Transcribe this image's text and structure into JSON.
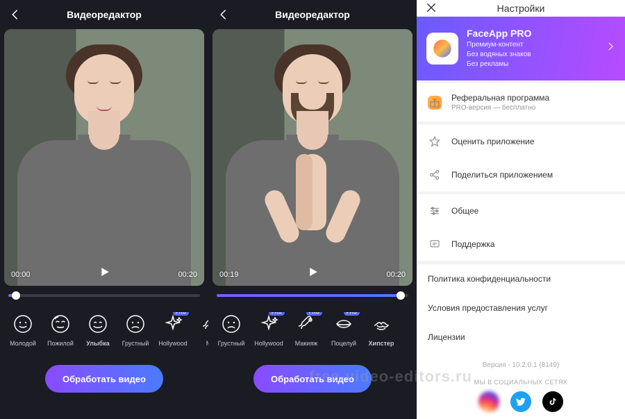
{
  "editor": {
    "title": "Видеоредактор",
    "process_label": "Обработать видео",
    "left": {
      "time_start": "00:00",
      "time_end": "00:20",
      "progress": 0.04
    },
    "right": {
      "time_start": "00:19",
      "time_end": "00:20",
      "progress": 0.96
    },
    "filters_left": [
      {
        "id": "young",
        "label": "Молодой",
        "icon": "face-happy",
        "pro": false,
        "active": false
      },
      {
        "id": "old",
        "label": "Пожилой",
        "icon": "face-old",
        "pro": false,
        "active": false
      },
      {
        "id": "smile",
        "label": "Улыбка",
        "icon": "face-smile",
        "pro": false,
        "active": true
      },
      {
        "id": "sad",
        "label": "Грустный",
        "icon": "face-sad",
        "pro": false,
        "active": false
      },
      {
        "id": "hollywood",
        "label": "Hollywood",
        "icon": "sparkle",
        "pro": true,
        "active": false
      },
      {
        "id": "makeup",
        "label": "Ма",
        "icon": "brush",
        "pro": false,
        "active": false
      }
    ],
    "filters_right": [
      {
        "id": "sad",
        "label": "Грустный",
        "icon": "face-sad",
        "pro": false,
        "active": false
      },
      {
        "id": "hollywood",
        "label": "Hollywood",
        "icon": "sparkle",
        "pro": true,
        "active": false
      },
      {
        "id": "makeup",
        "label": "Макияж",
        "icon": "brush",
        "pro": true,
        "active": false
      },
      {
        "id": "kiss",
        "label": "Поцелуй",
        "icon": "lips",
        "pro": true,
        "active": false
      },
      {
        "id": "hipster",
        "label": "Хипстер",
        "icon": "mustache",
        "pro": false,
        "active": true
      }
    ],
    "pro_badge": "PRO"
  },
  "settings": {
    "title": "Настройки",
    "pro": {
      "title": "FaceApp PRO",
      "line1": "Премиум-контент",
      "line2": "Без водяных знаков",
      "line3": "Без рекламы"
    },
    "referral": {
      "title": "Реферальная программа",
      "sub": "PRO-версия — бесплатно"
    },
    "rate": "Оценить приложение",
    "share": "Поделиться приложением",
    "general": "Общее",
    "support": "Поддержка",
    "privacy": "Политика конфиденциальности",
    "terms": "Условия предоставления услуг",
    "licenses": "Лицензии",
    "version": "Версия - 10.2.0.1 (8149)",
    "social_header": "МЫ В СОЦИАЛЬНЫХ СЕТЯХ"
  },
  "watermark": "free-video-editors.ru"
}
